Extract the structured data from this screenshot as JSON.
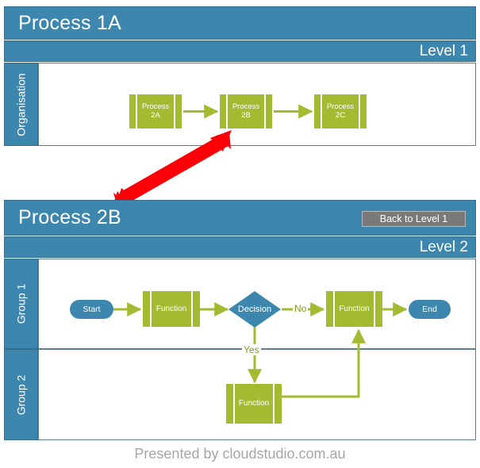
{
  "footer": {
    "text": "Presented by cloudstudio.com.au"
  },
  "colors": {
    "header_blue": "#3d87ae",
    "header_blue_border": "#356f8f",
    "process_green": "#a2bb31",
    "process_shadow": "#eef0e2",
    "button_gray": "#7a7a7a",
    "button_border": "#b9b9b9",
    "arrow_red": "#fb0007",
    "footer_gray": "#a6a6a6",
    "panel_border": "#5a7d95",
    "lane_white": "#ffffff"
  },
  "panel_top": {
    "title": "Process 1A",
    "level_label": "Level 1",
    "lane_label": "Organisation",
    "nodes": [
      {
        "id": "p2a",
        "label": "Process\n2A",
        "type": "subprocess"
      },
      {
        "id": "p2b",
        "label": "Process\n2B",
        "type": "subprocess"
      },
      {
        "id": "p2c",
        "label": "Process\n2C",
        "type": "subprocess"
      }
    ],
    "edges": [
      {
        "from": "p2a",
        "to": "p2b",
        "label": ""
      },
      {
        "from": "p2b",
        "to": "p2c",
        "label": ""
      }
    ]
  },
  "panel_bottom": {
    "title": "Process 2B",
    "level_label": "Level 2",
    "back_button": "Back to Level 1",
    "lanes": [
      {
        "id": "g1",
        "label": "Group 1"
      },
      {
        "id": "g2",
        "label": "Group 2"
      }
    ],
    "nodes": [
      {
        "id": "start",
        "label": "Start",
        "type": "terminator",
        "lane": "g1"
      },
      {
        "id": "fn1",
        "label": "Function",
        "type": "subprocess",
        "lane": "g1"
      },
      {
        "id": "dec",
        "label": "Decision",
        "type": "decision",
        "lane": "g1"
      },
      {
        "id": "fn2",
        "label": "Function",
        "type": "subprocess",
        "lane": "g1"
      },
      {
        "id": "end",
        "label": "End",
        "type": "terminator",
        "lane": "g1"
      },
      {
        "id": "fn3",
        "label": "Function",
        "type": "subprocess",
        "lane": "g2"
      }
    ],
    "edges": [
      {
        "from": "start",
        "to": "fn1",
        "label": ""
      },
      {
        "from": "fn1",
        "to": "dec",
        "label": ""
      },
      {
        "from": "dec",
        "to": "fn2",
        "label": "No"
      },
      {
        "from": "fn2",
        "to": "end",
        "label": ""
      },
      {
        "from": "dec",
        "to": "fn3",
        "label": "Yes"
      },
      {
        "from": "fn3",
        "to": "fn2",
        "label": ""
      }
    ]
  },
  "drilldown_arrow": {
    "type": "double-headed-arrow",
    "color": "#fb0007",
    "from": "Process 2B box (Level 1)",
    "to": "Process 2B panel (Level 2)"
  }
}
